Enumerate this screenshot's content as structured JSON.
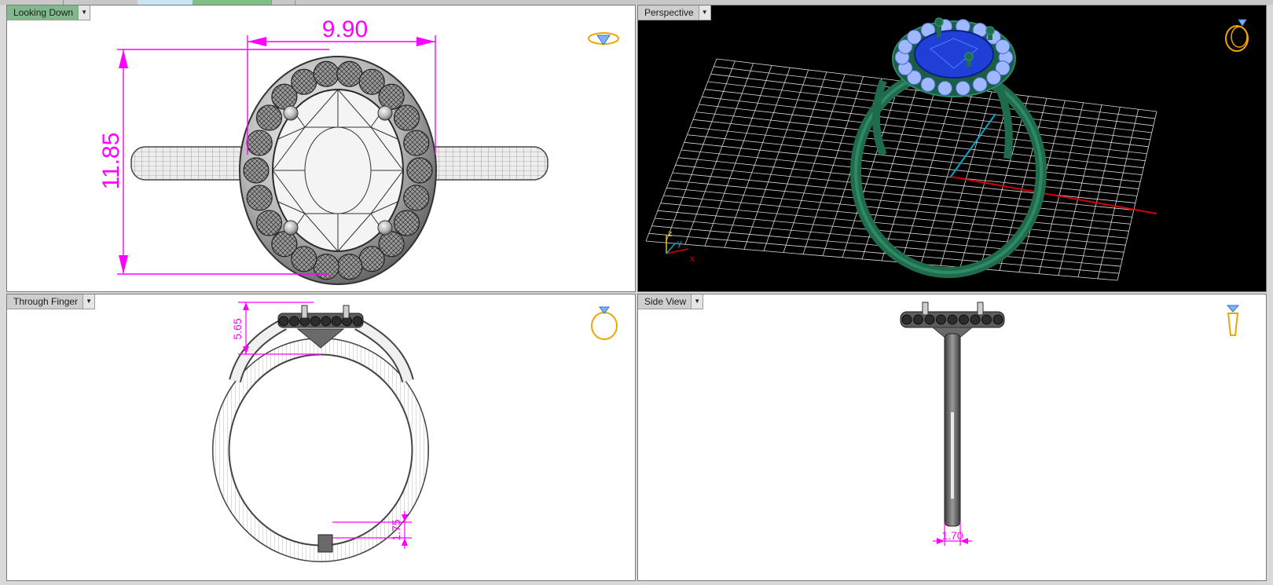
{
  "viewports": {
    "top_left": {
      "title": "Looking Down",
      "dim_width": "9.90",
      "dim_height": "11.85"
    },
    "top_right": {
      "title": "Perspective",
      "axis_x": "x",
      "axis_y": "y",
      "axis_z": "z"
    },
    "bottom_left": {
      "title": "Through Finger",
      "dim_head": "5.65",
      "dim_shank": "1.75"
    },
    "bottom_right": {
      "title": "Side View",
      "dim_width": "1.70"
    }
  },
  "icons": {
    "dropdown": "chevron-down-icon",
    "nav_top_left": "ring-top-view-icon",
    "nav_top_right": "ring-perspective-icon",
    "nav_bottom_left": "ring-front-view-icon",
    "nav_bottom_right": "ring-side-view-icon"
  },
  "colors": {
    "active_title": "#82b98c",
    "dimension": "#ff00ff",
    "ring_perspective": "#1f6b4d",
    "center_stone": "#1f3fd6",
    "halo_stones": "#9fb8ff",
    "grid": "#ffffff",
    "x_axis": "#d40000",
    "y_axis": "#00a7c7"
  }
}
